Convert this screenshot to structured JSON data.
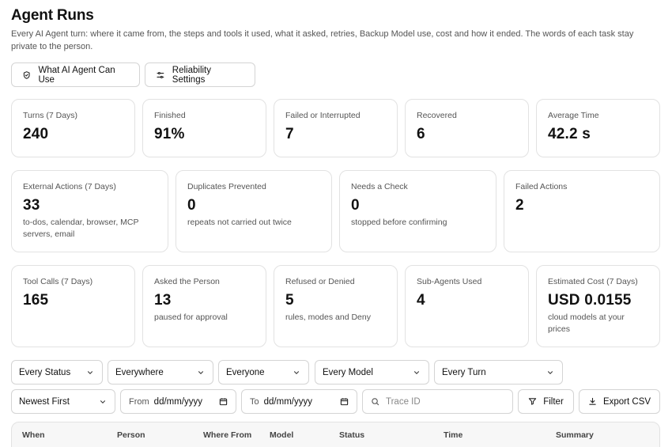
{
  "header": {
    "title": "Agent Runs",
    "subtitle": "Every AI Agent turn: where it came from, the steps and tools it used, what it asked, retries, Backup Model use, cost and how it ended. The words of each task stay private to the person."
  },
  "actions": {
    "capabilities_label": "What AI Agent Can Use",
    "reliability_label": "Reliability Settings"
  },
  "stats_row1": [
    {
      "label": "Turns (7 Days)",
      "value": "240"
    },
    {
      "label": "Finished",
      "value": "91%"
    },
    {
      "label": "Failed or Interrupted",
      "value": "7"
    },
    {
      "label": "Recovered",
      "value": "6"
    },
    {
      "label": "Average Time",
      "value": "42.2 s"
    }
  ],
  "stats_row2": [
    {
      "label": "External Actions (7 Days)",
      "value": "33",
      "note": "to-dos, calendar, browser, MCP servers, email"
    },
    {
      "label": "Duplicates Prevented",
      "value": "0",
      "note": "repeats not carried out twice"
    },
    {
      "label": "Needs a Check",
      "value": "0",
      "note": "stopped before confirming"
    },
    {
      "label": "Failed Actions",
      "value": "2",
      "note": ""
    }
  ],
  "stats_row3": [
    {
      "label": "Tool Calls (7 Days)",
      "value": "165",
      "note": ""
    },
    {
      "label": "Asked the Person",
      "value": "13",
      "note": "paused for approval"
    },
    {
      "label": "Refused or Denied",
      "value": "5",
      "note": "rules, modes and Deny"
    },
    {
      "label": "Sub-Agents Used",
      "value": "4",
      "note": ""
    },
    {
      "label": "Estimated Cost (7 Days)",
      "value": "USD 0.0155",
      "note": "cloud models at your prices"
    }
  ],
  "filters": {
    "status": "Every Status",
    "source": "Everywhere",
    "person": "Everyone",
    "model": "Every Model",
    "turn": "Every Turn",
    "sort": "Newest First",
    "from_label": "From",
    "from_value": "dd/mm/yyyy",
    "to_label": "To",
    "to_value": "dd/mm/yyyy",
    "trace_placeholder": "Trace ID",
    "filter_label": "Filter",
    "export_label": "Export CSV"
  },
  "table": {
    "columns": [
      "When",
      "Person",
      "Where From",
      "Model",
      "Status",
      "Time",
      "Summary"
    ]
  },
  "icons": {
    "capabilities": "shield-check-icon",
    "reliability": "sliders-icon",
    "filter": "funnel-icon",
    "export": "download-icon",
    "search": "search-icon",
    "calendar": "calendar-icon",
    "chevron": "chevron-down-icon"
  }
}
